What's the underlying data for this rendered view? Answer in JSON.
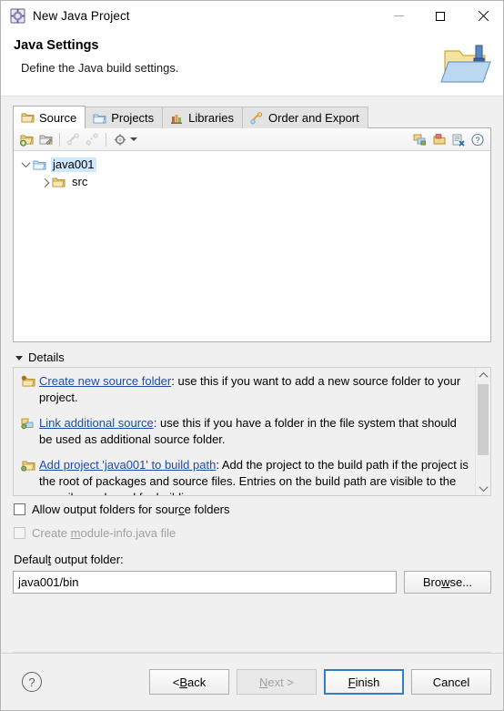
{
  "window": {
    "title": "New Java Project",
    "icon": "java-project-icon",
    "controls": {
      "minimize": "minimize-icon",
      "maximize": "maximize-icon",
      "close": "close-icon"
    }
  },
  "header": {
    "title": "Java Settings",
    "description": "Define the Java build settings.",
    "banner_icon": "java-build-folder-icon"
  },
  "tabs": [
    {
      "label": "Source",
      "icon": "source-folder-icon",
      "active": true
    },
    {
      "label": "Projects",
      "icon": "projects-icon",
      "active": false
    },
    {
      "label": "Libraries",
      "icon": "libraries-icon",
      "active": false
    },
    {
      "label": "Order and Export",
      "icon": "order-export-icon",
      "active": false
    }
  ],
  "tree_toolbar": {
    "buttons": [
      {
        "name": "add-folder-icon",
        "enabled": true
      },
      {
        "name": "edit-folder-icon",
        "enabled": true
      },
      {
        "name": "link-source-icon",
        "enabled": false
      },
      {
        "name": "unlink-source-icon",
        "enabled": false
      },
      {
        "name": "configure-gear-icon",
        "enabled": true
      }
    ],
    "right_buttons": [
      {
        "name": "collapse-all-icon",
        "enabled": true
      },
      {
        "name": "add-existing-icon",
        "enabled": true
      },
      {
        "name": "remove-entry-icon",
        "enabled": true
      },
      {
        "name": "toolbar-help-icon",
        "enabled": true
      }
    ]
  },
  "tree": {
    "nodes": [
      {
        "label": "java001",
        "icon": "project-folder-icon",
        "expanded": true,
        "selected": true,
        "indent": 0
      },
      {
        "label": "src",
        "icon": "source-folder-icon",
        "expanded": false,
        "selected": false,
        "indent": 1
      }
    ]
  },
  "details": {
    "section_label": "Details",
    "items": [
      {
        "icon": "create-source-folder-icon",
        "link": "Create new source folder",
        "text": ": use this if you want to add a new source folder to your project."
      },
      {
        "icon": "link-additional-source-icon",
        "link": "Link additional source",
        "text": ": use this if you have a folder in the file system that should be used as additional source folder."
      },
      {
        "icon": "add-project-build-path-icon",
        "link": "Add project 'java001' to build path",
        "text": ": Add the project to the build path if the project is the root of packages and source files. Entries on the build path are visible to the compiler and used for building."
      }
    ]
  },
  "options": {
    "allow_output_folders": {
      "label_prefix": "Allow output folders for sour",
      "label_mnemonic": "c",
      "label_suffix": "e folders",
      "checked": false,
      "enabled": true
    },
    "create_module_info": {
      "label_prefix": "Create ",
      "label_mnemonic": "m",
      "label_suffix": "odule-info.java file",
      "checked": false,
      "enabled": false
    }
  },
  "output_folder": {
    "label_prefix": "Defaul",
    "label_mnemonic": "t",
    "label_suffix": " output folder:",
    "value": "java001/bin",
    "placeholder": "",
    "browse_label_prefix": "Bro",
    "browse_label_mnemonic": "w",
    "browse_label_suffix": "se..."
  },
  "footer": {
    "help_glyph": "?",
    "buttons": [
      {
        "name": "back-button",
        "prefix": "< ",
        "mnemonic": "B",
        "suffix": "ack",
        "enabled": true,
        "default": false
      },
      {
        "name": "next-button",
        "prefix": "",
        "mnemonic": "N",
        "suffix": "ext >",
        "enabled": false,
        "default": false
      },
      {
        "name": "finish-button",
        "prefix": "",
        "mnemonic": "F",
        "suffix": "inish",
        "enabled": true,
        "default": true
      },
      {
        "name": "cancel-button",
        "prefix": "Cancel",
        "mnemonic": "",
        "suffix": "",
        "enabled": true,
        "default": false
      }
    ]
  },
  "colors": {
    "link": "#1c4ea8",
    "selection": "#cde8ff",
    "dialog_bg": "#f0f0f0",
    "focus_border": "#2e7ec8"
  }
}
